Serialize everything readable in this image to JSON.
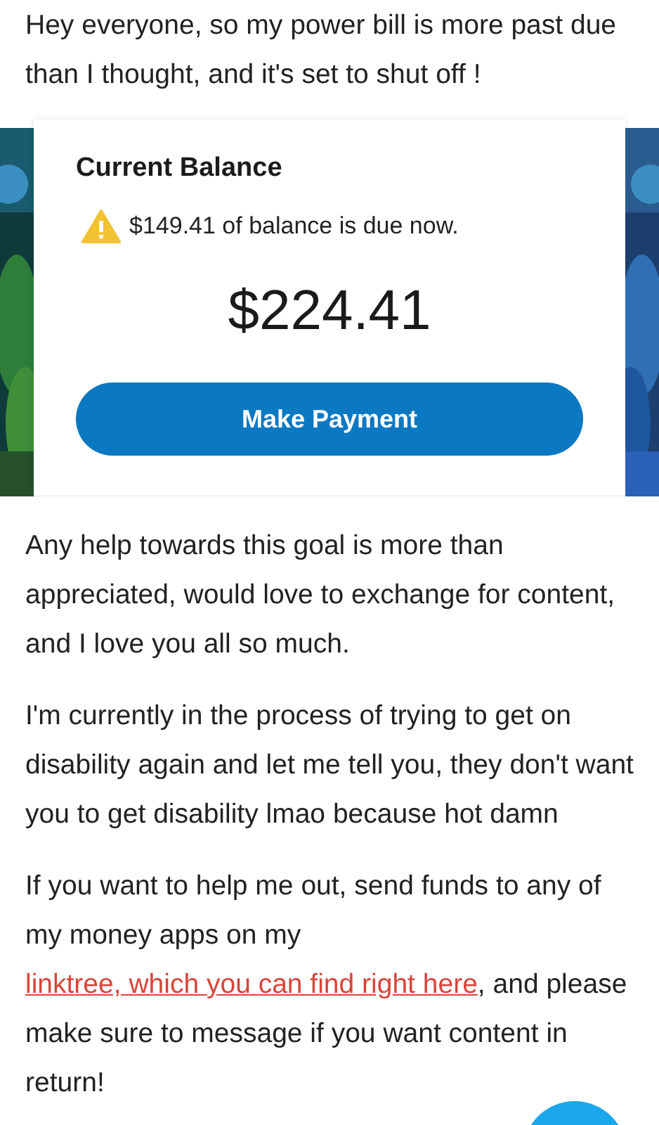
{
  "intro": "Hey everyone, so my power bill is more past due than I thought, and it's set to shut off !",
  "bill_card": {
    "title": "Current Balance",
    "warning": "$149.41 of balance is due now.",
    "amount": "$224.41",
    "button": "Make Payment"
  },
  "paragraphs": [
    {
      "parts": [
        {
          "kind": "text",
          "text": "Any help towards this goal is more than appreciated, would love to exchange for content, and I love you all so much."
        }
      ]
    },
    {
      "parts": [
        {
          "kind": "text",
          "text": "I'm currently in the process of trying to get on disability again and let me tell you, they don't want you to get disability lmao because hot damn"
        }
      ]
    },
    {
      "parts": [
        {
          "kind": "text",
          "text": "If you want to help me out, send funds to any of my money apps on my "
        },
        {
          "kind": "link",
          "text": "linktree, which you can find right here"
        },
        {
          "kind": "text",
          "text": ", and please make sure to message if you want content in return!"
        }
      ]
    }
  ]
}
